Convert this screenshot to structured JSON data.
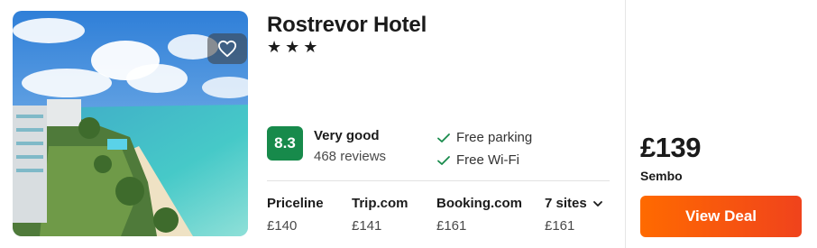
{
  "hotel": {
    "name": "Rostrevor Hotel",
    "stars": "★★★",
    "rating": {
      "score": "8.3",
      "label": "Very good",
      "reviews": "468 reviews",
      "color": "#178a4b"
    },
    "amenities": [
      {
        "icon": "check-icon",
        "label": "Free parking"
      },
      {
        "icon": "check-icon",
        "label": "Free Wi-Fi"
      }
    ],
    "favorite_icon": "heart-outline-icon"
  },
  "sites": [
    {
      "name": "Priceline",
      "price": "£140"
    },
    {
      "name": "Trip.com",
      "price": "£141"
    },
    {
      "name": "Booking.com",
      "price": "£161"
    },
    {
      "name": "7 sites",
      "price": "£161",
      "icon": "chevron-down-icon"
    }
  ],
  "deal": {
    "price": "£139",
    "provider": "Sembo",
    "button_label": "View Deal",
    "button_color": "#f5531a"
  }
}
